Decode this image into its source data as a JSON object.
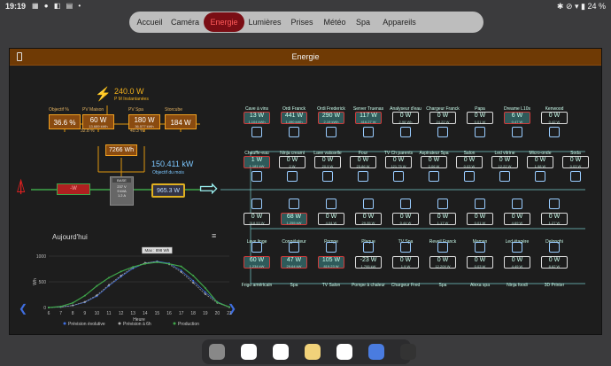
{
  "status": {
    "time": "19:19",
    "icons": "▦ ● ◧ ▤ •",
    "right": "✱ ⊘ ▾ ▮ 24 %"
  },
  "tabs": [
    "Accueil",
    "Caméra",
    "Energie",
    "Lumières",
    "Prises",
    "Météo",
    "Spa",
    "Appareils"
  ],
  "active_tab": "Energie",
  "window_title": "Energie",
  "solar": {
    "value": "240.0 W",
    "label": "P M Instantanées"
  },
  "objectives": [
    {
      "label": "Objectif %",
      "value": "36.6 %",
      "sub": ""
    },
    {
      "label": "PV Maison",
      "value": "60 W",
      "sub": "13.689 kWh"
    },
    {
      "label": "PV Spa",
      "value": "180 W",
      "sub": "36.577 kWh"
    },
    {
      "label": "Storcube",
      "value": "184 W",
      "sub": ""
    }
  ],
  "pct_left": "32.8 %",
  "pct_right": "40.3 %",
  "pv_total": "7266 Wh",
  "month_value": "150.411 kW",
  "month_label": "Objectif du mois",
  "grid_value": "-W",
  "base": {
    "label": "BASE",
    "v": "237 V",
    "va": "9 kVA",
    "a": "1.2 A"
  },
  "house_value": "965.3 W",
  "chart": {
    "title": "Aujourd'hui",
    "tooltip": "Max : 898 Wh",
    "ylabel": "Wh",
    "xlabel": "Heure",
    "yticks": [
      "1000",
      "500",
      "0"
    ],
    "xticks": [
      "6",
      "7",
      "8",
      "9",
      "10",
      "11",
      "12",
      "13",
      "14",
      "15",
      "16",
      "17",
      "18",
      "19",
      "20",
      "21"
    ],
    "legend": [
      "Prévision évolutive",
      "Prévision à 6h",
      "Production"
    ],
    "menu_icon": "≡",
    "nav_prev": "❮",
    "nav_next": "❯"
  },
  "chart_data": {
    "type": "line",
    "x": [
      6,
      7,
      8,
      9,
      10,
      11,
      12,
      13,
      14,
      15,
      16,
      17,
      18,
      19,
      20,
      21
    ],
    "series": [
      {
        "name": "Prévision évolutive",
        "values": [
          0,
          10,
          40,
          100,
          220,
          420,
          600,
          760,
          860,
          898,
          860,
          720,
          520,
          300,
          110,
          10
        ]
      },
      {
        "name": "Prévision à 6h",
        "values": [
          0,
          10,
          40,
          110,
          240,
          440,
          620,
          780,
          870,
          890,
          840,
          690,
          480,
          260,
          90,
          5
        ]
      },
      {
        "name": "Production",
        "values": [
          0,
          20,
          90,
          230,
          420,
          580,
          700,
          790,
          850,
          880,
          850,
          800,
          620,
          380,
          100,
          10
        ]
      }
    ],
    "ylim": [
      0,
      1000
    ],
    "title": "Aujourd'hui",
    "xlabel": "Heure",
    "ylabel": "Wh"
  },
  "devices_row1": [
    {
      "name": "Cave à vins",
      "value": "13 W",
      "sub": "1.104 kWh",
      "on": true
    },
    {
      "name": "Ordi Franck",
      "value": "441 W",
      "sub": "1.490 kWh",
      "on": true
    },
    {
      "name": "Ordi Frederick",
      "value": "290 W",
      "sub": "2.19 kWh",
      "on": true
    },
    {
      "name": "Server Truenas",
      "value": "117 W",
      "sub": "416.27 W",
      "on": true
    },
    {
      "name": "Analyseur d'eau",
      "value": "0 W",
      "sub": "2.98 Wh",
      "on": false
    },
    {
      "name": "Chargeur Franck",
      "value": "0 W",
      "sub": "24.22 W",
      "on": false
    },
    {
      "name": "Papa",
      "value": "0 W",
      "sub": "0.01 W",
      "on": false
    },
    {
      "name": "Dreame L10s",
      "value": "6 W",
      "sub": "0.47 W",
      "on": true
    },
    {
      "name": "Kenwood",
      "value": "0 W",
      "sub": "0.42 W",
      "on": false
    }
  ],
  "devices_row2": [
    {
      "name": "Chauffe-eau",
      "value": "1 W",
      "sub": "1.181 kW",
      "on": true
    },
    {
      "name": "Ninja creami",
      "value": "0 W",
      "sub": "0 W",
      "on": false
    },
    {
      "name": "Lave vaisselle",
      "value": "0 W",
      "sub": "20.9 W",
      "on": false
    },
    {
      "name": "Four",
      "value": "0 W",
      "sub": "25.86 W",
      "on": false
    },
    {
      "name": "TV Ch parents",
      "value": "0 W",
      "sub": "121.75 W",
      "on": false
    },
    {
      "name": "Aspirateur Spa",
      "value": "0 W",
      "sub": "0.06 W",
      "on": false
    },
    {
      "name": "Salon",
      "value": "0 W",
      "sub": "0.03 W",
      "on": false
    },
    {
      "name": "Led vitrine",
      "value": "0 W",
      "sub": "12.22 W",
      "on": false
    },
    {
      "name": "Micro-onde",
      "value": "0 W",
      "sub": "1.98 W",
      "on": false
    },
    {
      "name": "Soda",
      "value": "0 W",
      "sub": "0.03 W",
      "on": false
    }
  ],
  "devices_row3": [
    {
      "name": "Lave linge",
      "value": "0 W",
      "sub": "318.53 W",
      "on": false
    },
    {
      "name": "Congélateur",
      "value": "68 W",
      "sub": "1.255 kW",
      "on": true
    },
    {
      "name": "Pompe",
      "value": "0 W",
      "sub": "4.04 W",
      "on": false
    },
    {
      "name": "Plaque",
      "value": "0 W",
      "sub": "29.35 W",
      "on": false
    },
    {
      "name": "TV Spa",
      "value": "0 W",
      "sub": "0.44 W",
      "on": false
    },
    {
      "name": "Reveil Franck",
      "value": "0 W",
      "sub": "1.17 W",
      "on": false
    },
    {
      "name": "Maman",
      "value": "0 W",
      "sub": "0.01 W",
      "on": false
    },
    {
      "name": "Led étagère",
      "value": "0 W",
      "sub": "4.69 W",
      "on": false
    },
    {
      "name": "Delonghi",
      "value": "0 W",
      "sub": "1.27 W",
      "on": false
    }
  ],
  "devices_row4": [
    {
      "name": "Frigo américain",
      "value": "60 W",
      "sub": "1.234 kW",
      "on": true
    },
    {
      "name": "Spa",
      "value": "47 W",
      "sub": "29.64 kW",
      "on": true
    },
    {
      "name": "TV Salon",
      "value": "105 W",
      "sub": "819.23 W",
      "on": true
    },
    {
      "name": "Pompe à chaleur",
      "value": "-23 W",
      "sub": "1.795 kW",
      "on": false
    },
    {
      "name": "Chargeur Fred",
      "value": "0 W",
      "sub": "1.9 W",
      "on": false
    },
    {
      "name": "Spa",
      "value": "0 W",
      "sub": "12.209 W",
      "on": false
    },
    {
      "name": "Alexa spa",
      "value": "0 W",
      "sub": "0.03 W",
      "on": false
    },
    {
      "name": "Ninja foodi",
      "value": "0 W",
      "sub": "4.49 W",
      "on": false
    },
    {
      "name": "3D Printer",
      "value": "0 W",
      "sub": "8.62 W",
      "on": false
    }
  ],
  "dock_apps": [
    "gallery-app",
    "gmail-app",
    "chrome-app",
    "notes-app",
    "youtube-app",
    "files-app",
    "camera-app"
  ]
}
